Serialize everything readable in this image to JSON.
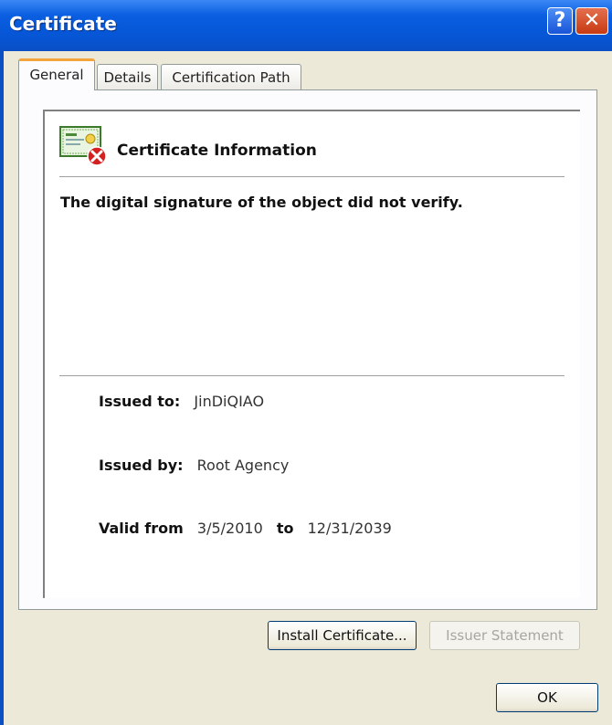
{
  "window": {
    "title": "Certificate"
  },
  "titlebar": {
    "help_glyph": "?",
    "close_glyph": "✕"
  },
  "tabs": [
    {
      "label": "General",
      "active": true
    },
    {
      "label": "Details",
      "active": false
    },
    {
      "label": "Certification Path",
      "active": false
    }
  ],
  "info": {
    "heading": "Certificate Information",
    "message": "The digital signature of the object did not verify.",
    "icon": "certificate-error-icon"
  },
  "fields": {
    "issued_to_label": "Issued to:",
    "issued_to_value": "JinDiQIAO",
    "issued_by_label": "Issued by:",
    "issued_by_value": "Root Agency",
    "valid_from_label": "Valid from",
    "valid_from_value": "3/5/2010",
    "to_label": "to",
    "valid_to_value": "12/31/2039"
  },
  "buttons": {
    "install": "Install Certificate...",
    "issuer": "Issuer Statement",
    "ok": "OK"
  },
  "colors": {
    "titlebar": "#0656d6",
    "accent_tab": "#f3a43c",
    "error": "#d42020"
  }
}
